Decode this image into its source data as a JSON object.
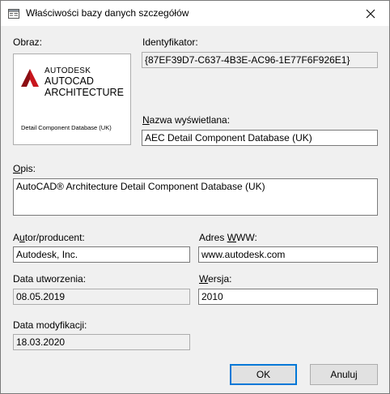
{
  "window": {
    "title": "Właściwości bazy danych szczegółów",
    "icon": "window-icon",
    "close_icon": "close-icon"
  },
  "image_section": {
    "label": "Obraz:",
    "logo": {
      "line1": "AUTODESK",
      "line2": "AUTOCAD",
      "line3": "ARCHITECTURE",
      "caption": "Detail Component Database (UK)",
      "brand_color": "#c8161d"
    }
  },
  "identifier": {
    "label": "Identyfikator:",
    "value": "{87EF39D7-C637-4B3E-AC96-1E77F6F926E1}"
  },
  "display_name": {
    "label_underlined": "N",
    "label_rest": "azwa wyświetlana:",
    "value": "AEC Detail Component Database (UK)"
  },
  "description": {
    "label_underlined": "O",
    "label_rest": "pis:",
    "value": "AutoCAD® Architecture Detail Component Database (UK)"
  },
  "author": {
    "label_pre": "A",
    "label_underlined": "u",
    "label_rest": "tor/producent:",
    "value": "Autodesk, Inc."
  },
  "website": {
    "label_pre": "Adres ",
    "label_underlined": "W",
    "label_rest": "WW:",
    "value": "www.autodesk.com"
  },
  "created": {
    "label": "Data utworzenia:",
    "value": "08.05.2019"
  },
  "version": {
    "label_underlined": "W",
    "label_rest": "ersja:",
    "value": "2010"
  },
  "modified": {
    "label": "Data modyfikacji:",
    "value": "18.03.2020"
  },
  "buttons": {
    "ok": "OK",
    "cancel": "Anuluj"
  }
}
